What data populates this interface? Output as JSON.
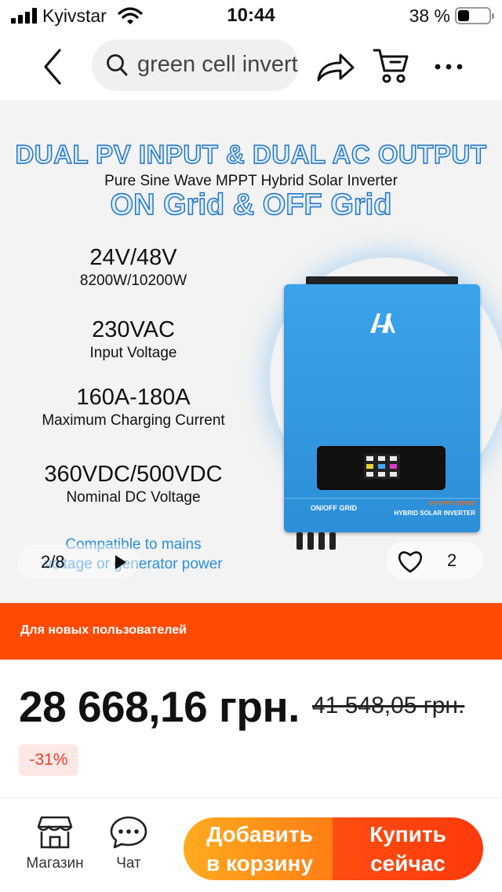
{
  "status_bar": {
    "carrier": "Kyivstar",
    "time": "10:44",
    "battery_percent_label": "38 %",
    "battery_level": 0.38
  },
  "nav": {
    "search_text": "green cell inverter"
  },
  "gallery": {
    "headline_1": "DUAL PV INPUT  &  DUAL AC OUTPUT",
    "headline_2": "Pure Sine Wave MPPT Hybrid Solar Inverter",
    "headline_3": "ON Grid & OFF Grid",
    "specs": [
      {
        "value": "24V/48V",
        "label": "8200W/10200W"
      },
      {
        "value": "230VAC",
        "label": "Input Voltage"
      },
      {
        "value": "160A-180A",
        "label": "Maximum Charging Current"
      },
      {
        "value": "360VDC/500VDC",
        "label": "Nominal DC Voltage"
      }
    ],
    "compat_line_1": "Compatible to mains",
    "compat_line_2": "voltage or generator power",
    "device": {
      "strip_left": "ON/OFF GRID",
      "strip_series": "EH-TRPO SERIES",
      "strip_right": "HYBRID SOLAR INVERTER",
      "body_color": "#3aa3ea"
    },
    "slide_counter": "2/8",
    "like_count": "2"
  },
  "promo": {
    "text": "Для новых пользователей",
    "color": "#fd4b06"
  },
  "price": {
    "current": "28 668,16 грн.",
    "old": "41 548,05 грн.",
    "discount": "-31%"
  },
  "bottom_bar": {
    "shop_label": "Магазин",
    "chat_label": "Чат",
    "add_to_cart_line_1": "Добавить",
    "add_to_cart_line_2": "в корзину",
    "buy_now_line_1": "Купить",
    "buy_now_line_2": "сейчас"
  }
}
